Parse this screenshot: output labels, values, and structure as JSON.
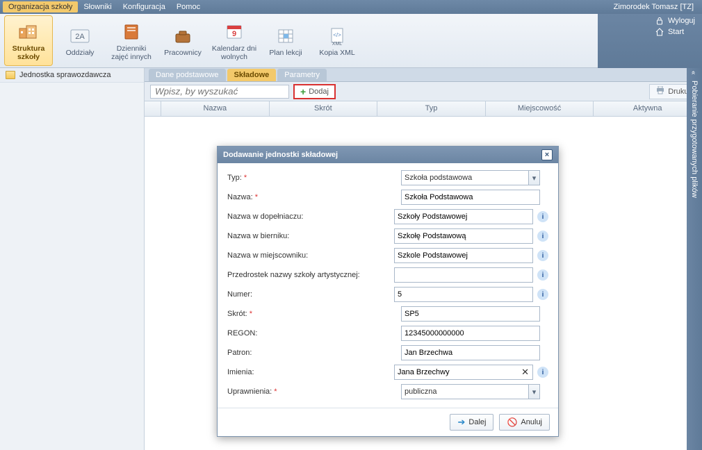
{
  "menu": {
    "items": [
      "Organizacja szkoły",
      "Słowniki",
      "Konfiguracja",
      "Pomoc"
    ],
    "active_index": 0,
    "user": "Zimorodek Tomasz [TZ]"
  },
  "right_links": {
    "logout": "Wyloguj",
    "start": "Start"
  },
  "ribbon": {
    "items": [
      {
        "label": "Struktura szkoły",
        "icon": "school-structure"
      },
      {
        "label": "Oddziały",
        "icon": "class-2a"
      },
      {
        "label": "Dzienniki zajęć innych",
        "icon": "journal"
      },
      {
        "label": "Pracownicy",
        "icon": "employees"
      },
      {
        "label": "Kalendarz dni wolnych",
        "icon": "calendar"
      },
      {
        "label": "Plan lekcji",
        "icon": "timetable"
      },
      {
        "label": "Kopia XML",
        "icon": "xml"
      }
    ],
    "active_index": 0
  },
  "sidebar": {
    "items": [
      {
        "label": "Jednostka sprawozdawcza"
      }
    ]
  },
  "tabs": {
    "items": [
      "Dane podstawowe",
      "Składowe",
      "Parametry"
    ],
    "active_index": 1
  },
  "toolbar": {
    "search_placeholder": "Wpisz, by wyszukać",
    "add_label": "Dodaj",
    "print_label": "Drukuj"
  },
  "grid": {
    "columns": [
      "Nazwa",
      "Skrót",
      "Typ",
      "Miejscowość",
      "Aktywna"
    ]
  },
  "modal": {
    "title": "Dodawanie jednostki składowej",
    "fields": {
      "typ": {
        "label": "Typ:",
        "required": true,
        "value": "Szkoła podstawowa",
        "type": "select"
      },
      "nazwa": {
        "label": "Nazwa:",
        "required": true,
        "value": "Szkoła Podstawowa",
        "type": "text"
      },
      "dopelniacz": {
        "label": "Nazwa w dopełniaczu:",
        "value": "Szkoły Podstawowej",
        "type": "text",
        "info": true
      },
      "biernik": {
        "label": "Nazwa w bierniku:",
        "value": "Szkołę Podstawową",
        "type": "text",
        "info": true
      },
      "miejscownik": {
        "label": "Nazwa w miejscowniku:",
        "value": "Szkole Podstawowej",
        "type": "text",
        "info": true
      },
      "przedrostek": {
        "label": "Przedrostek nazwy szkoły artystycznej:",
        "value": "",
        "type": "text",
        "info": true
      },
      "numer": {
        "label": "Numer:",
        "value": "5",
        "type": "text",
        "info": true
      },
      "skrot": {
        "label": "Skrót:",
        "required": true,
        "value": "SP5",
        "type": "text"
      },
      "regon": {
        "label": "REGON:",
        "value": "12345000000000",
        "type": "text"
      },
      "patron": {
        "label": "Patron:",
        "value": "Jan Brzechwa",
        "type": "text"
      },
      "imienia": {
        "label": "Imienia:",
        "value": "Jana Brzechwy",
        "type": "text",
        "info": true,
        "clearable": true
      },
      "uprawnienia": {
        "label": "Uprawnienia:",
        "required": true,
        "value": "publiczna",
        "type": "select"
      }
    },
    "buttons": {
      "next": "Dalej",
      "cancel": "Anuluj"
    }
  },
  "right_panel": {
    "label": "Pobieranie przygotowanych plików"
  }
}
